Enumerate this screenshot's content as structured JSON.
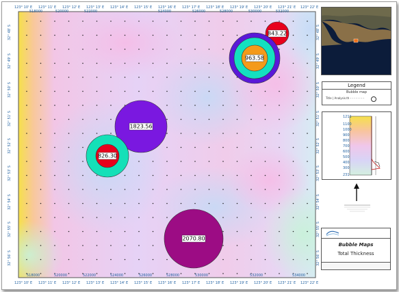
{
  "lon_labels_top": [
    "123° 10' E",
    "123° 11' E",
    "123° 12' E",
    "123° 13' E",
    "123° 14' E",
    "123° 15' E",
    "123° 16' E",
    "123° 17' E",
    "123° 18' E",
    "123° 19' E",
    "123° 20' E",
    "123° 21' E",
    "123° 22' E"
  ],
  "easting_labels_top": [
    "518000",
    "520000",
    "522000",
    "524000",
    "526000",
    "528000",
    "530000",
    "532000"
  ],
  "lon_labels_bottom": [
    "123° 10' E",
    "123° 11' E",
    "123° 12' E",
    "123° 13' E",
    "123° 14' E",
    "123° 15' E",
    "123° 16' E",
    "123° 17' E",
    "123° 18' E",
    "123° 19' E",
    "123° 20' E",
    "123° 21' E",
    "123° 22' E"
  ],
  "easting_labels_bottom": [
    "518000",
    "520000",
    "522000",
    "524000",
    "526000",
    "528000",
    "530000",
    "532000",
    "534000"
  ],
  "lat_labels_left": [
    "32° 48' S",
    "32° 49' S",
    "32° 50' S",
    "32° 51' S",
    "32° 52' S",
    "32° 53' S",
    "32° 54' S",
    "32° 55' S",
    "32° 56' S"
  ],
  "lat_labels_right": [
    "32° 48' S",
    "32° 49' S",
    "32° 50' S",
    "32° 51' S",
    "32° 52' S",
    "32° 53' S",
    "32° 54' S",
    "32° 55' S",
    "32° 56' S"
  ],
  "bubbles": [
    {
      "label": "843.22",
      "rings": [
        "#e8001c"
      ]
    },
    {
      "label": "963.58",
      "rings": [
        "#5a18d8",
        "#14e0c0",
        "#f49a1a"
      ]
    },
    {
      "label": "1823.56",
      "rings": [
        "#7a18e0"
      ]
    },
    {
      "label": "826.30",
      "rings": [
        "#14e0b8",
        "#e8001c"
      ]
    },
    {
      "label": "2070.80",
      "rings": [
        "#9c0c84"
      ]
    }
  ],
  "legend": {
    "title": "Legend",
    "subtitle": "Bubble map",
    "item": "Title | Analysis.th - - - - - - - -"
  },
  "colorbar": {
    "ticks": [
      "1211",
      "1100",
      "1000",
      "900",
      "800",
      "700",
      "600",
      "500",
      "400",
      "300",
      "231"
    ]
  },
  "title_block": {
    "title": "Bubble Maps",
    "subtitle": "Total Thickness"
  },
  "colors": {
    "tick_text": "#2060a0",
    "frame": "#555555"
  }
}
